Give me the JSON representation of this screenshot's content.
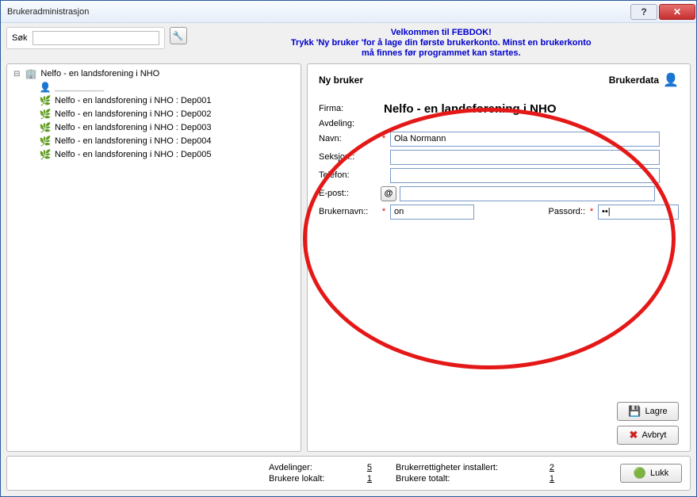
{
  "window": {
    "title": "Brukeradministrasjon"
  },
  "search": {
    "label": "Søk",
    "value": ""
  },
  "welcome": {
    "line1": "Velkommen til FEBDOK!",
    "line2": "Trykk 'Ny bruker 'for å lage din første brukerkonto. Minst en brukerkonto",
    "line3": "må finnes før programmet kan startes."
  },
  "tree": {
    "root": "Nelfo - en landsforening i NHO",
    "user_placeholder": "____________",
    "departments": [
      "Nelfo - en landsforening i NHO : Dep001",
      "Nelfo - en landsforening i NHO : Dep002",
      "Nelfo - en landsforening i NHO : Dep003",
      "Nelfo - en landsforening i NHO : Dep004",
      "Nelfo - en landsforening i NHO : Dep005"
    ]
  },
  "form": {
    "left_title": "Ny bruker",
    "right_title": "Brukerdata",
    "firma_label": "Firma:",
    "firma_value": "Nelfo - en landsforening i NHO",
    "avdeling_label": "Avdeling:",
    "navn_label": "Navn:",
    "navn_value": "Ola Normann",
    "seksjon_label": "Seksjon::",
    "seksjon_value": "",
    "telefon_label": "Telefon:",
    "telefon_value": "",
    "epost_label": "E-post::",
    "epost_value": "",
    "brukernavn_label": "Brukernavn::",
    "brukernavn_value": "on",
    "passord_label": "Passord::",
    "passord_value": "••|"
  },
  "buttons": {
    "lagre": "Lagre",
    "avbryt": "Avbryt",
    "lukk": "Lukk"
  },
  "status": {
    "avdelinger_label": "Avdelinger:",
    "avdelinger_value": "5",
    "brukere_lokalt_label": "Brukere lokalt:",
    "brukere_lokalt_value": "1",
    "rettigheter_label": "Brukerrettigheter installert:",
    "rettigheter_value": "2",
    "totalt_label": "Brukere totalt:",
    "totalt_value": "1"
  }
}
